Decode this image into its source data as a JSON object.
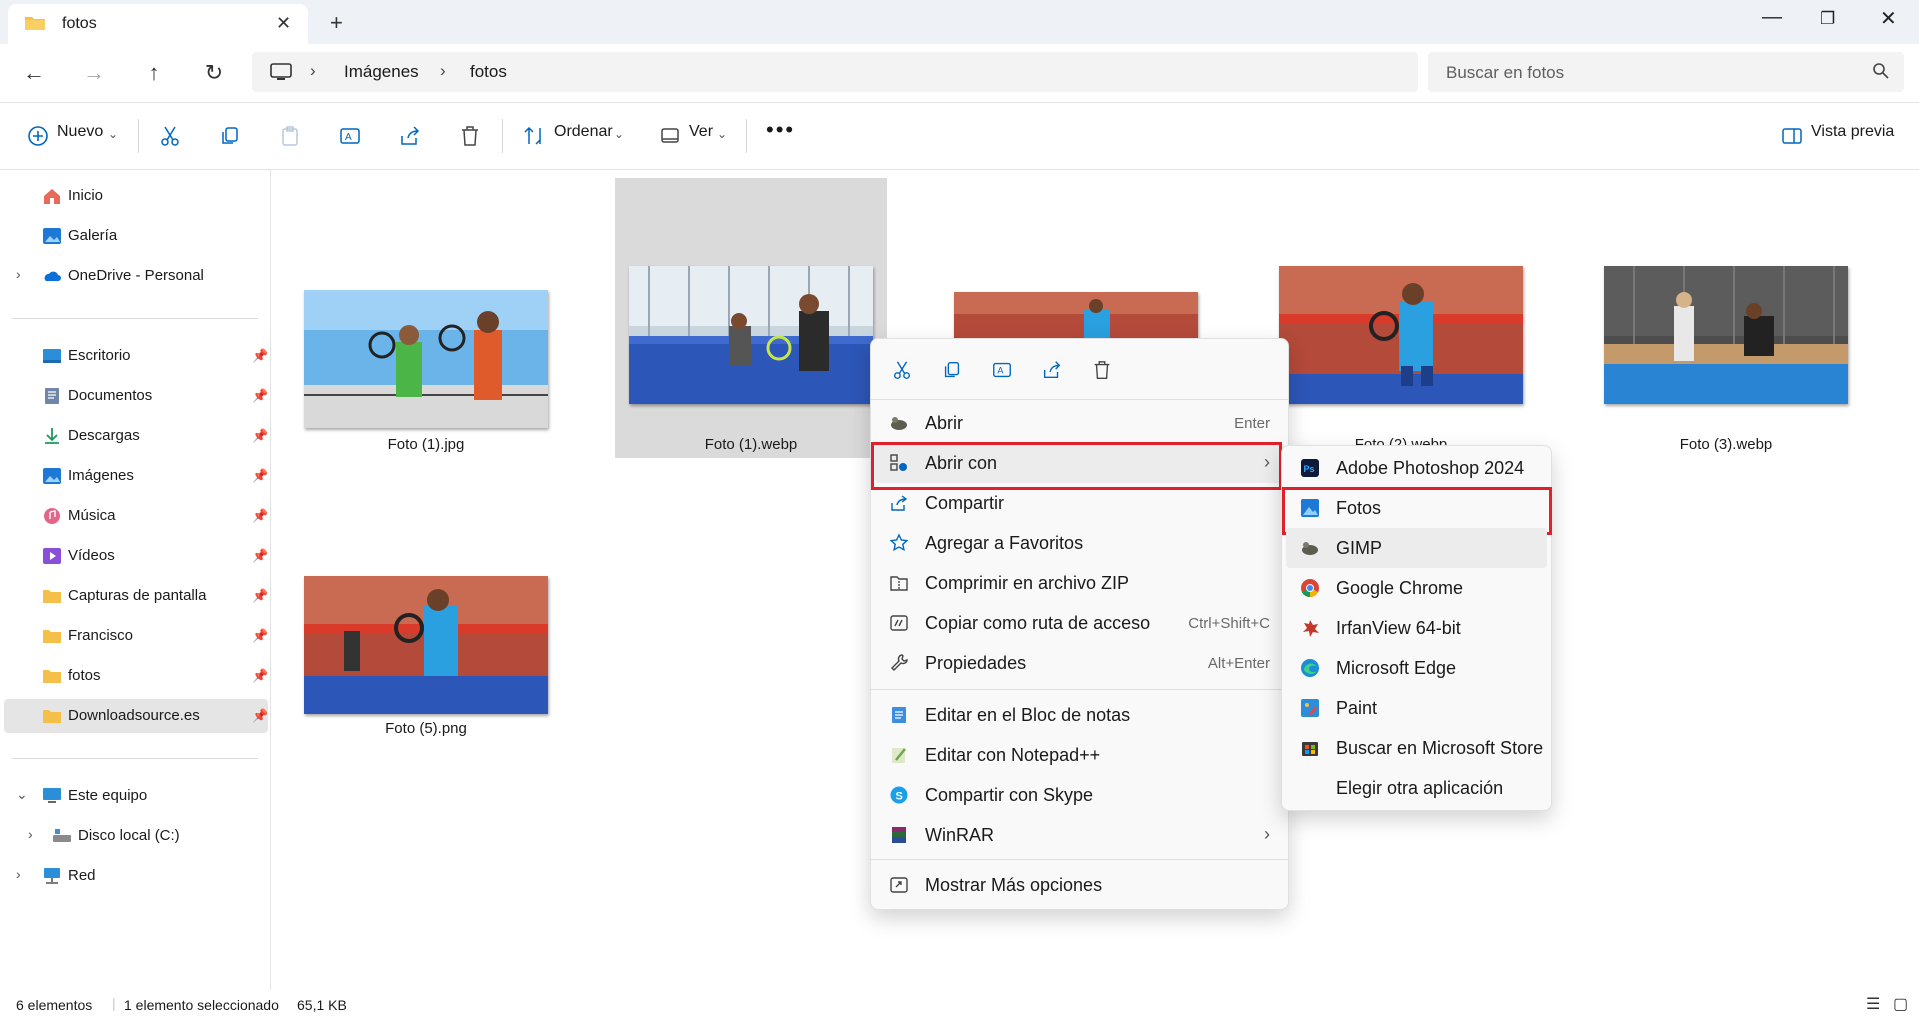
{
  "window": {
    "tab_title": "fotos"
  },
  "breadcrumb": {
    "items": [
      "Imágenes",
      "fotos"
    ]
  },
  "search": {
    "placeholder": "Buscar en fotos"
  },
  "commandbar": {
    "nuevo": "Nuevo",
    "ordenar": "Ordenar",
    "ver": "Ver",
    "vista_previa": "Vista previa"
  },
  "sidebar": {
    "inicio": "Inicio",
    "galeria": "Galería",
    "onedrive": "OneDrive - Personal",
    "escritorio": "Escritorio",
    "documentos": "Documentos",
    "descargas": "Descargas",
    "imagenes": "Imágenes",
    "musica": "Música",
    "videos": "Vídeos",
    "capturas": "Capturas de pantalla",
    "francisco": "Francisco",
    "fotos": "fotos",
    "downloadsource": "Downloadsource.es",
    "este_equipo": "Este equipo",
    "disco_local": "Disco local (C:)",
    "red": "Red"
  },
  "files": [
    {
      "name": "Foto (1).jpg"
    },
    {
      "name": "Foto (1).webp"
    },
    {
      "name": ""
    },
    {
      "name": "Foto (2).webp"
    },
    {
      "name": "Foto (3).webp"
    },
    {
      "name": "Foto (5).png"
    }
  ],
  "context_menu": {
    "abrir": "Abrir",
    "abrir_shortcut": "Enter",
    "abrir_con": "Abrir con",
    "compartir": "Compartir",
    "favoritos": "Agregar a Favoritos",
    "zip": "Comprimir en archivo ZIP",
    "copiar_ruta": "Copiar como ruta de acceso",
    "copiar_ruta_shortcut": "Ctrl+Shift+C",
    "propiedades": "Propiedades",
    "propiedades_shortcut": "Alt+Enter",
    "bloc": "Editar en el Bloc de notas",
    "notepadpp": "Editar con Notepad++",
    "skype": "Compartir con Skype",
    "winrar": "WinRAR",
    "mas_opciones": "Mostrar Más opciones"
  },
  "submenu": {
    "photoshop": "Adobe Photoshop 2024",
    "fotos": "Fotos",
    "gimp": "GIMP",
    "chrome": "Google Chrome",
    "irfanview": "IrfanView 64-bit",
    "edge": "Microsoft Edge",
    "paint": "Paint",
    "store": "Buscar en Microsoft Store",
    "otra": "Elegir otra aplicación"
  },
  "statusbar": {
    "count": "6 elementos",
    "selected": "1 elemento seleccionado",
    "size": "65,1 KB"
  },
  "colors": {
    "highlight": "#e0202a",
    "folder": "#f4c04a",
    "accent": "#0067c0"
  }
}
